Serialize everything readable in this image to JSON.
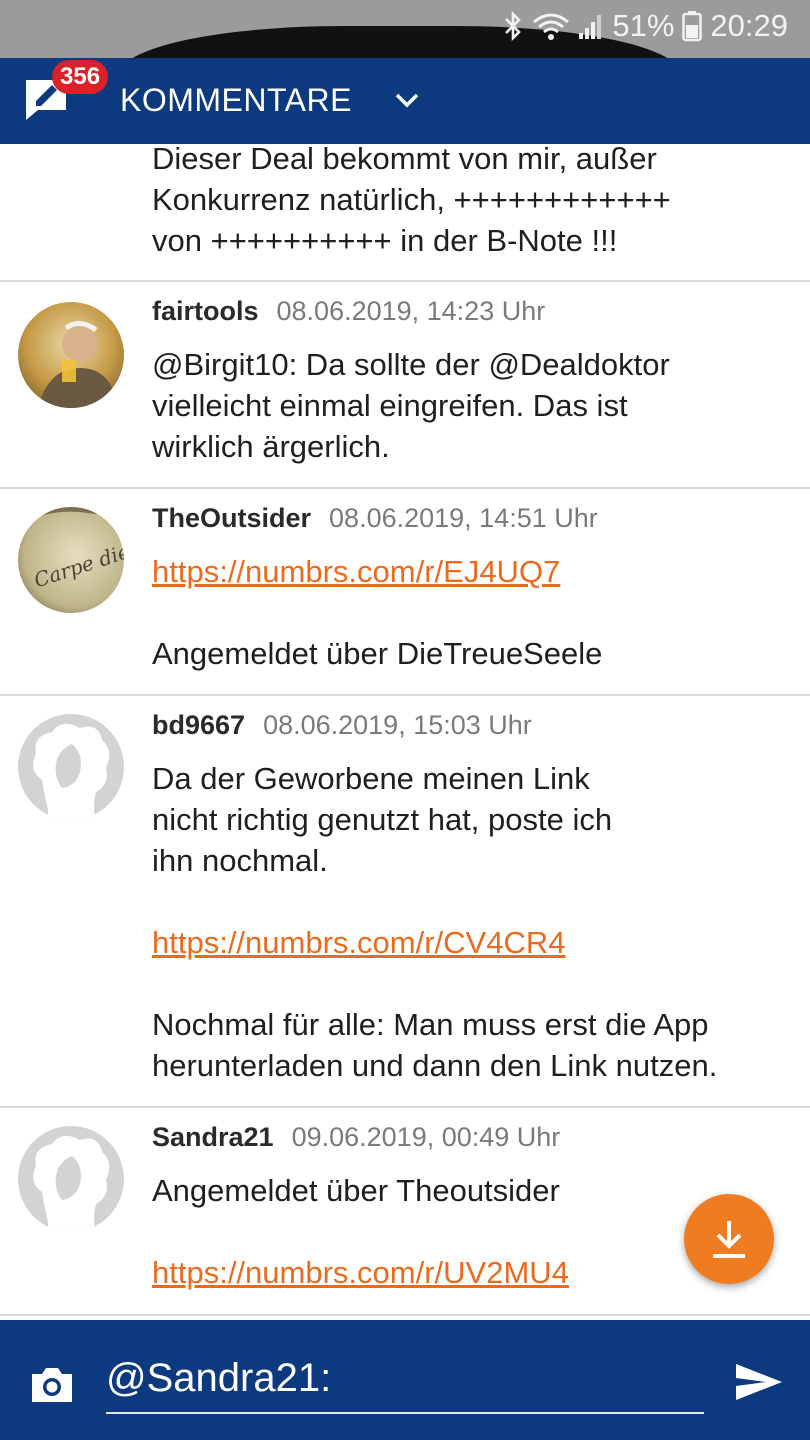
{
  "status_bar": {
    "battery_percent": "51%",
    "time": "20:29",
    "icons": [
      "bluetooth-icon",
      "wifi-icon",
      "signal-icon",
      "battery-icon"
    ]
  },
  "app_bar": {
    "badge_count": "356",
    "title": "KOMMENTARE",
    "icons": [
      "comment-edit-icon",
      "chevron-down-icon"
    ]
  },
  "comments": [
    {
      "author": "",
      "date": "",
      "body_lines": [
        "Dieser Deal bekommt von mir, außer",
        "Konkurrenz natürlich, ++++++++++++",
        "von ++++++++++ in der B-Note !!!"
      ]
    },
    {
      "author": "fairtools",
      "date": "08.06.2019, 14:23 Uhr",
      "body_lines": [
        "@Birgit10: Da sollte der @Dealdoktor",
        "vielleicht einmal eingreifen. Das ist",
        "wirklich ärgerlich."
      ]
    },
    {
      "author": "TheOutsider",
      "date": "08.06.2019, 14:51 Uhr",
      "link": "https://numbrs.com/r/EJ4UQ7",
      "after_text": "Angemeldet über DieTreueSeele",
      "avatar_text": "Carpe diem"
    },
    {
      "author": "bd9667",
      "date": "08.06.2019, 15:03 Uhr",
      "body_lines": [
        "Da der Geworbene meinen Link",
        "nicht richtig genutzt hat, poste ich",
        "ihn nochmal."
      ],
      "link": "https://numbrs.com/r/CV4CR4",
      "after_lines": [
        "Nochmal für alle: Man muss erst die App",
        "herunterladen und dann den Link nutzen."
      ]
    },
    {
      "author": "Sandra21",
      "date": "09.06.2019, 00:49 Uhr",
      "body_lines": [
        "Angemeldet über Theoutsider"
      ],
      "link": "https://numbrs.com/r/UV2MU4"
    }
  ],
  "fab": {
    "icon": "download-icon"
  },
  "input_bar": {
    "value": "@Sandra21:",
    "icons": [
      "camera-icon",
      "send-icon"
    ]
  },
  "colors": {
    "primary": "#0d3a7e",
    "accent": "#f07c22",
    "link": "#ea6b1e",
    "badge": "#d8232a"
  }
}
